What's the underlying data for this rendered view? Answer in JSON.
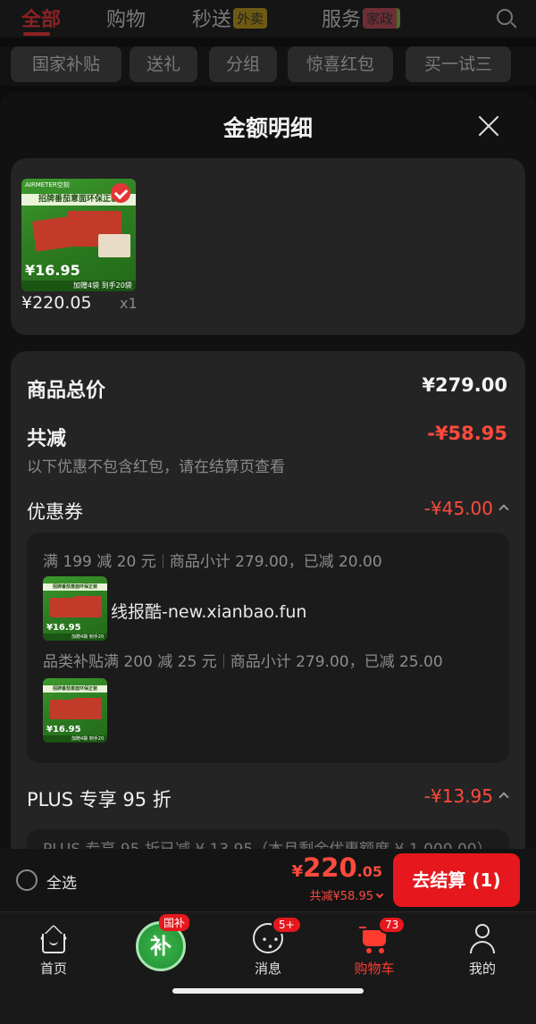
{
  "top_tabs": [
    {
      "label": "全部",
      "active": true
    },
    {
      "label": "购物"
    },
    {
      "label": "秒送",
      "tag": "外卖"
    },
    {
      "label": "服务",
      "tag": "家政"
    }
  ],
  "chips": [
    "国家补贴",
    "送礼",
    "分组",
    "惊喜红包",
    "买一试三"
  ],
  "sheet": {
    "title": "金额明细",
    "product": {
      "price": "¥220.05",
      "qty": "x1",
      "thumb": {
        "brand": "AIRMETER空刻",
        "headline": "招牌番茄意面环保正装",
        "price": "¥16.95",
        "promo": "加赠4袋 到手20袋"
      }
    },
    "summary": {
      "total_label": "商品总价",
      "total_value": "¥279.00",
      "reduce_label": "共减",
      "reduce_value": "-¥58.95",
      "hint": "以下优惠不包含红包，请在结算页查看"
    },
    "coupon": {
      "label": "优惠券",
      "value": "-¥45.00",
      "items": [
        {
          "rule": "满 199 减 20 元",
          "detail": "商品小计 279.00，已减 20.00"
        },
        {
          "rule": "品类补贴满 200 减 25 元",
          "detail": "商品小计 279.00，已减 25.00"
        }
      ],
      "watermark": "线报酷-new.xianbao.fun"
    },
    "plus": {
      "label": "PLUS 专享 95 折",
      "value": "-¥13.95",
      "detail": "PLUS 专享 95 折已减 ¥ 13.95（本月剩余优惠额度 ¥ 1,000.00）"
    }
  },
  "checkout": {
    "select_all": "全选",
    "currency": "¥",
    "total_int": "220",
    "total_dec": ".05",
    "saved": "共减¥58.95",
    "button": "去结算 (1)"
  },
  "tabbar": {
    "items": [
      {
        "label": "首页",
        "icon": "home-icon"
      },
      {
        "label": "",
        "icon": "subsidy-icon",
        "center": "补",
        "badge": "国补"
      },
      {
        "label": "消息",
        "icon": "message-icon",
        "badge": "5+"
      },
      {
        "label": "购物车",
        "icon": "cart-icon",
        "badge": "73",
        "active": true
      },
      {
        "label": "我的",
        "icon": "user-icon"
      }
    ]
  },
  "colors": {
    "accent": "#e6181d",
    "price_red": "#ff4a3d",
    "sheet_bg": "#111111",
    "card_bg": "#242424"
  }
}
